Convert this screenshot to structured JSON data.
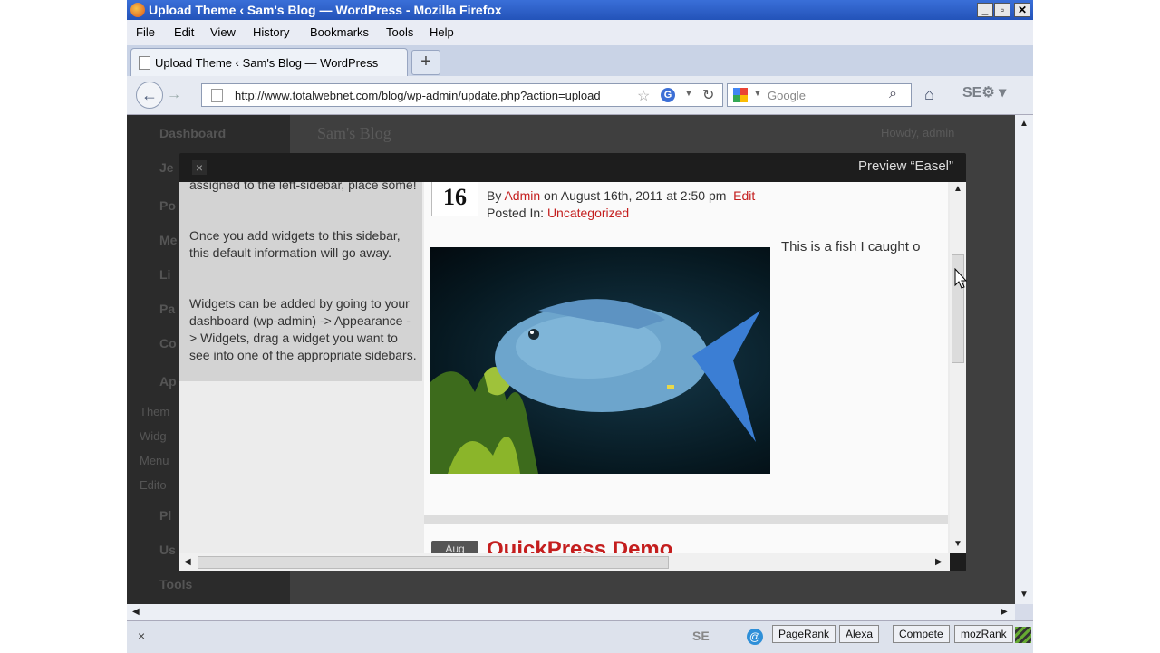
{
  "window": {
    "title": "Upload Theme ‹ Sam's Blog — WordPress - Mozilla Firefox"
  },
  "menubar": {
    "items": [
      "File",
      "Edit",
      "View",
      "History",
      "Bookmarks",
      "Tools",
      "Help"
    ]
  },
  "tab": {
    "label": "Upload Theme ‹ Sam's Blog — WordPress",
    "new_tab": "+"
  },
  "navbar": {
    "url": "http://www.totalwebnet.com/blog/wp-admin/update.php?action=upload",
    "search_placeholder": "Google",
    "seo_label": "SE"
  },
  "admin": {
    "menu_items": [
      "Dashboard",
      "Je",
      "Po",
      "Me",
      "Li",
      "Pa",
      "Co",
      "Ap",
      "Them",
      "Widg",
      "Menu",
      "Edito",
      "Pl",
      "Us",
      "Tools"
    ],
    "site_title": "Sam's Blog",
    "howdy": "Howdy, admin"
  },
  "modal": {
    "close": "×",
    "title": "Preview “Easel”"
  },
  "sidebar": {
    "p1": "assigned to the left-sidebar, place some!",
    "p2": "Once you add widgets to this sidebar, this default information will go away.",
    "p3": "Widgets can be added by going to your dashboard (wp-admin) -> Appearance -> Widgets, drag a widget you want to see into one of the appropriate sidebars."
  },
  "post": {
    "day": "16",
    "by": "By",
    "author": "Admin",
    "date_text": "on August 16th, 2011 at 2:50 pm",
    "edit": "Edit",
    "posted_in": "Posted In:",
    "category": "Uncategorized",
    "text": "This is a fish I caught o"
  },
  "next_post": {
    "month": "Aug",
    "title": "QuickPress Demo"
  },
  "statusbar": {
    "close": "×",
    "seo": "SE",
    "buttons": [
      "PageRank",
      "Alexa",
      "Compete",
      "mozRank"
    ]
  }
}
